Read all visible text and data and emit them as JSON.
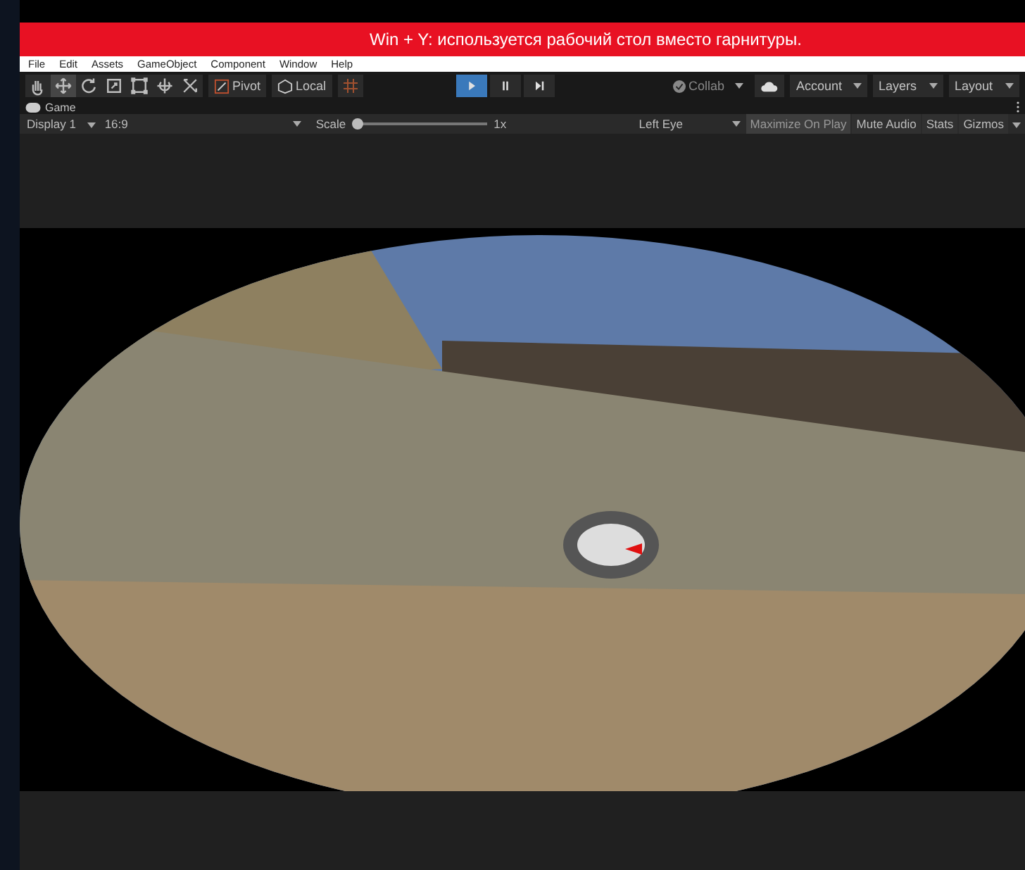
{
  "notification": {
    "text": "Win + Y: используется рабочий стол вместо гарнитуры."
  },
  "menu": [
    "File",
    "Edit",
    "Assets",
    "GameObject",
    "Component",
    "Window",
    "Help"
  ],
  "toolbar": {
    "tools": [
      {
        "kind": "hand",
        "selected": false
      },
      {
        "kind": "move",
        "selected": true
      },
      {
        "kind": "rotate",
        "selected": false
      },
      {
        "kind": "scale",
        "selected": false
      },
      {
        "kind": "rect",
        "selected": false
      },
      {
        "kind": "transform",
        "selected": false
      },
      {
        "kind": "custom",
        "selected": false
      }
    ],
    "pivot": "Pivot",
    "local": "Local",
    "play": [
      {
        "kind": "play",
        "selected": true
      },
      {
        "kind": "pause",
        "selected": false
      },
      {
        "kind": "step",
        "selected": false
      }
    ],
    "collab": "Collab",
    "account": "Account",
    "layers": "Layers",
    "layout": "Layout"
  },
  "tab": {
    "label": "Game"
  },
  "game_bar": {
    "display": "Display 1",
    "aspect": "16:9",
    "scale_label": "Scale",
    "scale": {
      "level": 0.0
    },
    "scale_value": "1x",
    "eye": "Left Eye",
    "toggles": [
      {
        "label": "Maximize On Play",
        "on": true
      },
      {
        "label": "Mute Audio",
        "on": false
      },
      {
        "label": "Stats",
        "on": false
      },
      {
        "label": "Gizmos",
        "on": false
      }
    ]
  }
}
